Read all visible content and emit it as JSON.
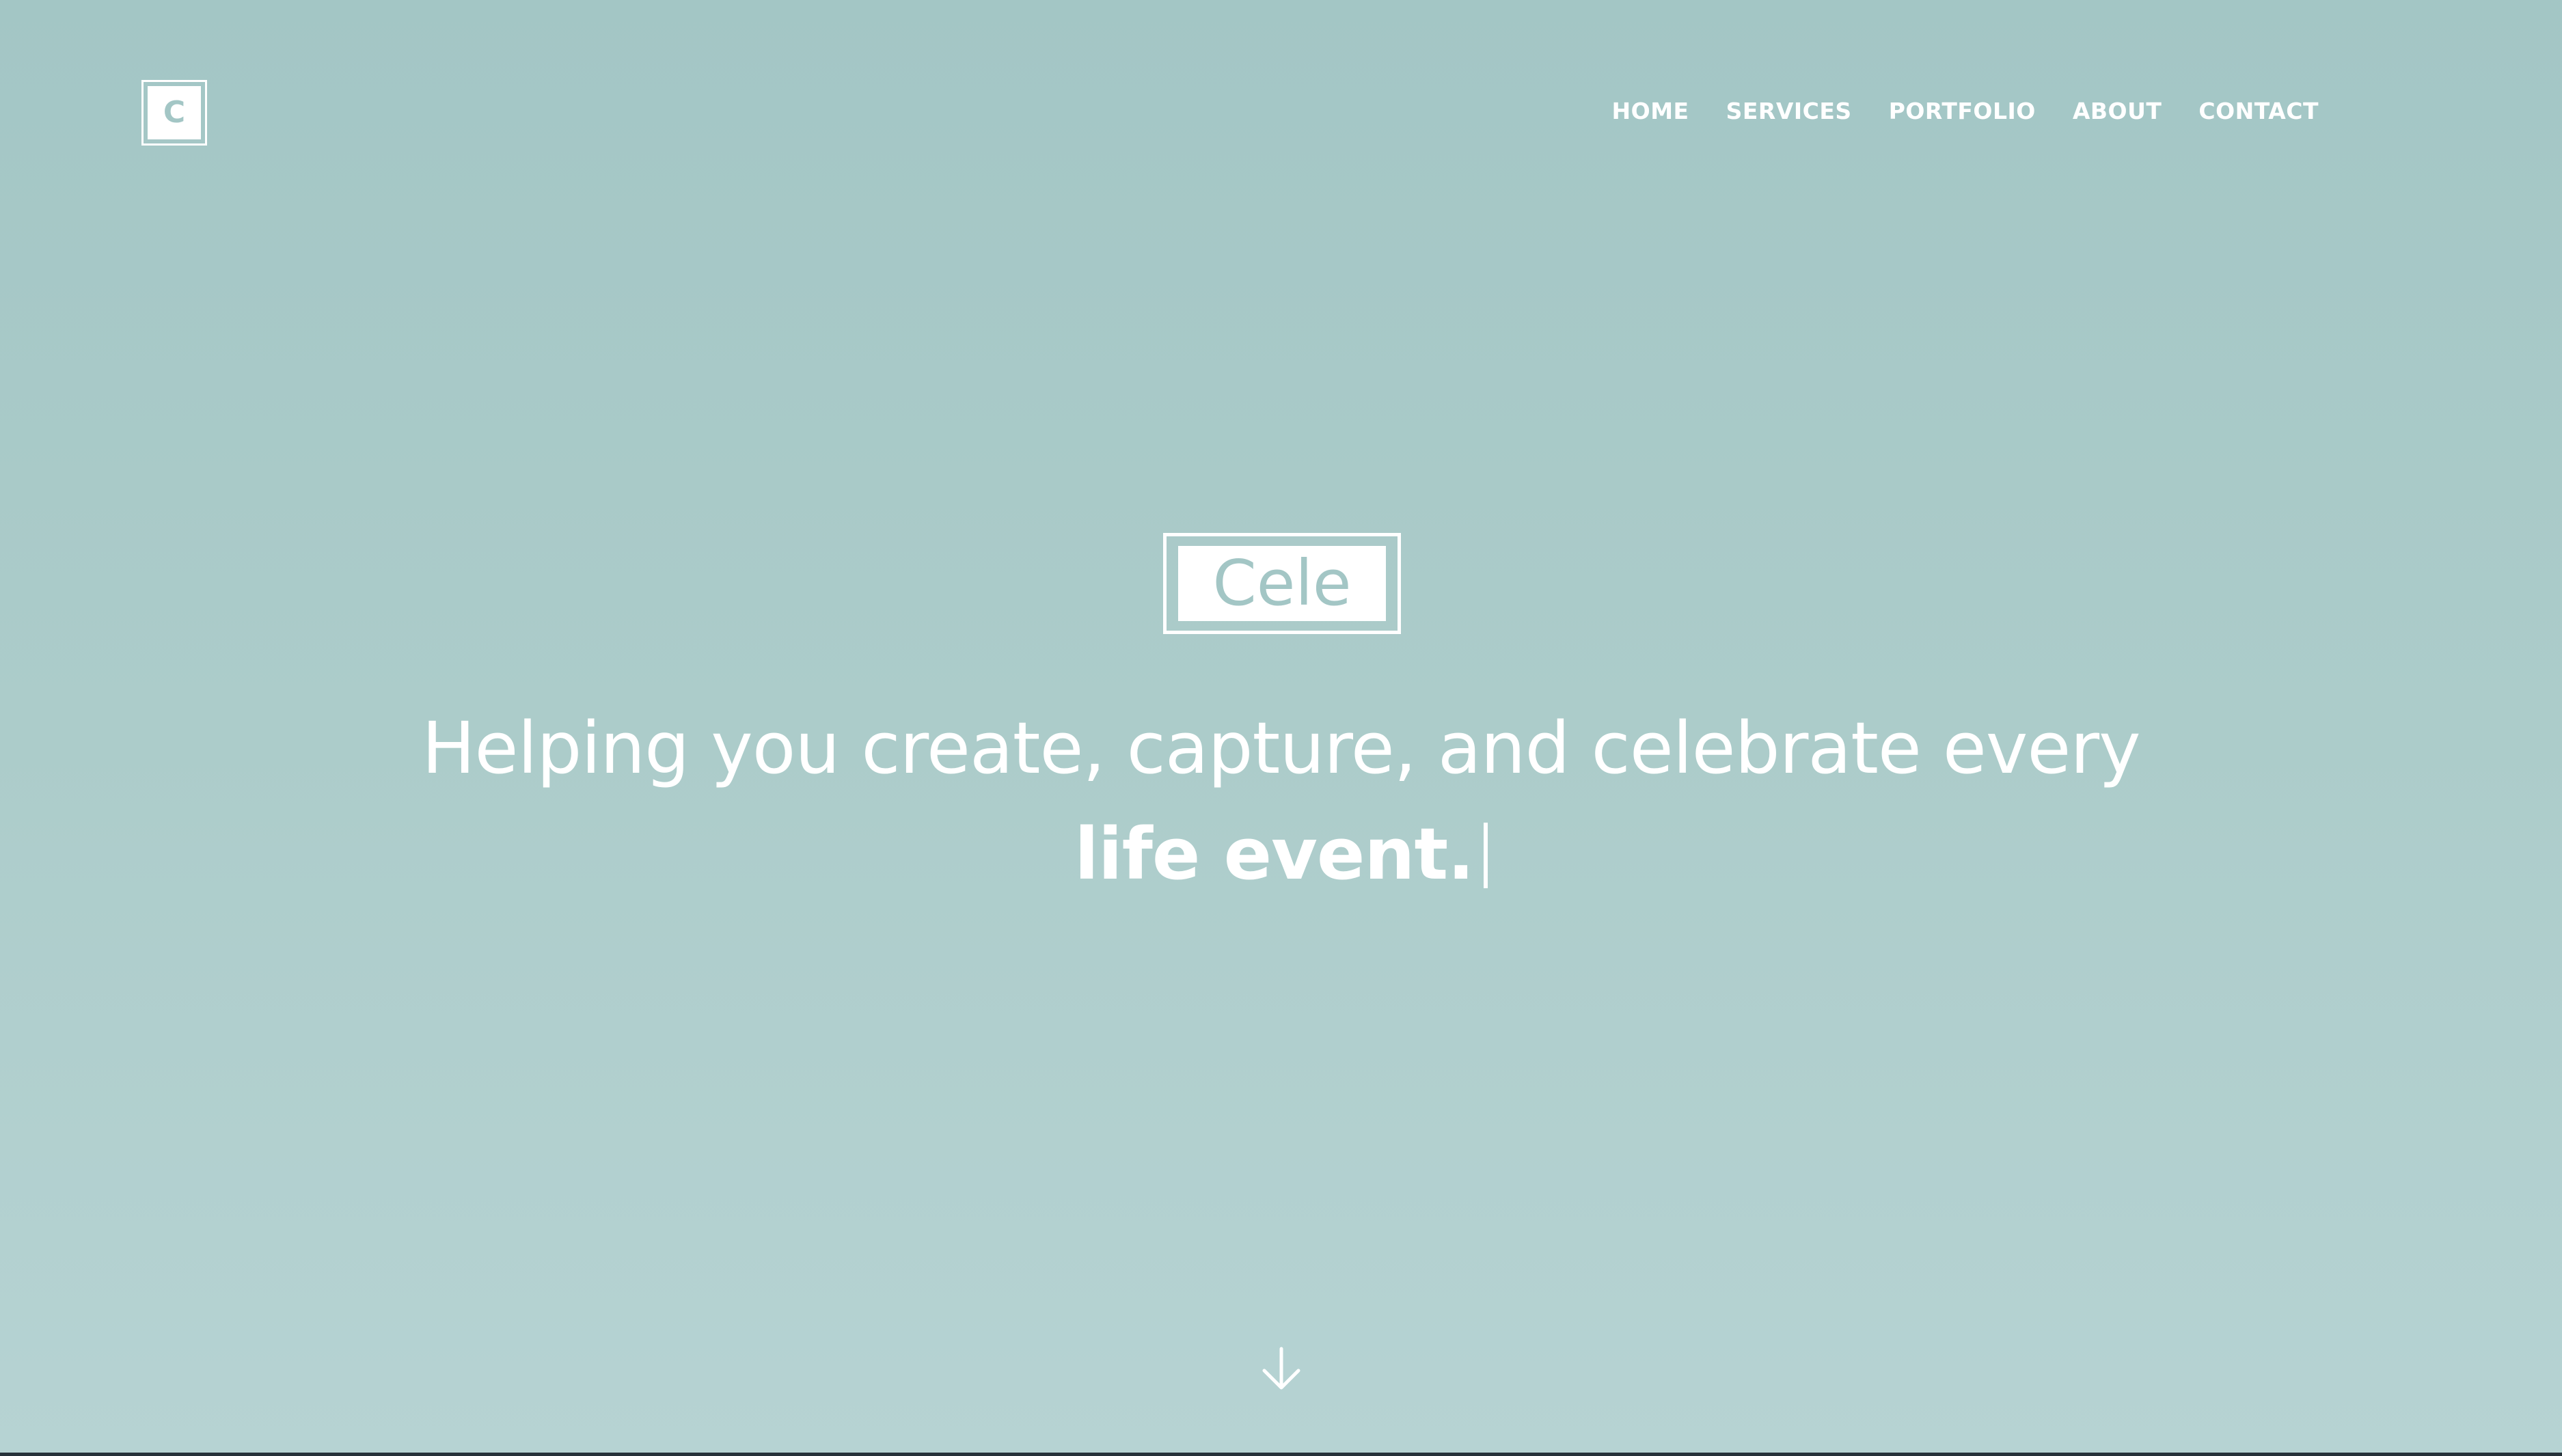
{
  "logo": {
    "letter": "C"
  },
  "nav": {
    "items": [
      {
        "label": "HOME"
      },
      {
        "label": "SERVICES"
      },
      {
        "label": "PORTFOLIO"
      },
      {
        "label": "ABOUT"
      },
      {
        "label": "CONTACT"
      }
    ]
  },
  "hero": {
    "brand": "Cele",
    "headline_line1": "Helping you create, capture, and celebrate every",
    "headline_line2": "life event.",
    "scroll_icon": "arrow-down-icon"
  },
  "colors": {
    "background_top": "#a3c6c5",
    "background_bottom": "#b6d3d3",
    "text": "#ffffff",
    "accent": "#a3c6c5"
  }
}
